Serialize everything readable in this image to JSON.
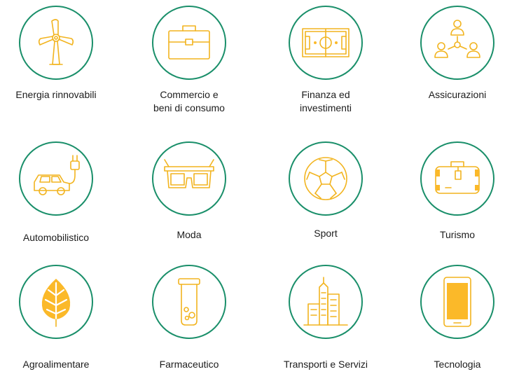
{
  "accent_color": "#fbb929",
  "circle_border_color": "#1a8f6a",
  "sectors": [
    {
      "icon": "wind-turbine-icon",
      "label": "Energia rinnovabili"
    },
    {
      "icon": "briefcase-icon",
      "label_lines": [
        "Commercio e",
        "beni di consumo"
      ]
    },
    {
      "icon": "banknote-icon",
      "label_lines": [
        "Finanza ed",
        "investimenti"
      ]
    },
    {
      "icon": "people-network-icon",
      "label": "Assicurazioni"
    },
    {
      "icon": "electric-car-icon",
      "label": "Automobilistico"
    },
    {
      "icon": "glasses-icon",
      "label": "Moda"
    },
    {
      "icon": "soccer-ball-icon",
      "label": "Sport"
    },
    {
      "icon": "suitcase-icon",
      "label": "Turismo"
    },
    {
      "icon": "leaf-icon",
      "label": "Agroalimentare"
    },
    {
      "icon": "test-tube-icon",
      "label": "Farmaceutico"
    },
    {
      "icon": "buildings-icon",
      "label": "Transporti e Servizi"
    },
    {
      "icon": "smartphone-icon",
      "label": "Tecnologia"
    }
  ]
}
